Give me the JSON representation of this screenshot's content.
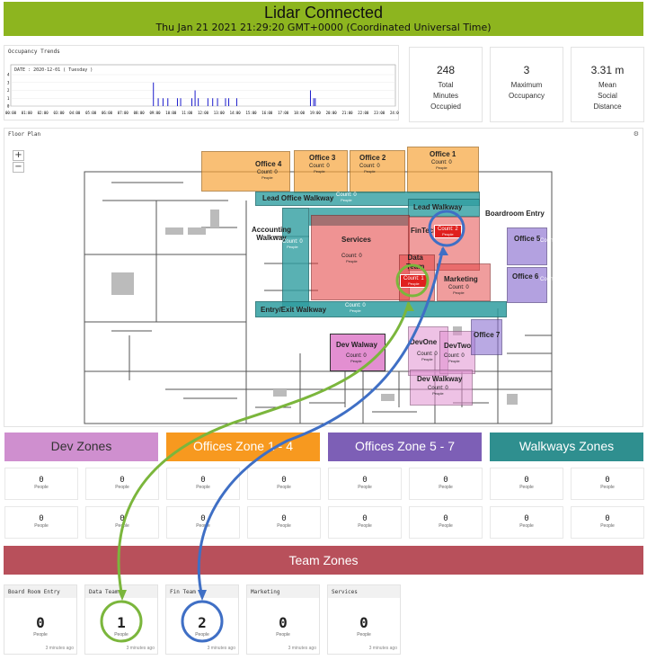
{
  "header": {
    "title": "Lidar Connected",
    "subtitle": "Thu Jan 21 2021 21:29:20 GMT+0000 (Coordinated Universal Time)"
  },
  "trends": {
    "title": "Occupancy Trends",
    "date_label": "DATE : 2020-12-01 ( Tuesday )",
    "y_ticks": [
      "4",
      "3",
      "2",
      "1",
      "0"
    ],
    "x_ticks": [
      "00:00",
      "01:00",
      "02:00",
      "03:00",
      "04:00",
      "05:00",
      "06:00",
      "07:00",
      "08:00",
      "09:00",
      "10:00",
      "11:00",
      "12:00",
      "13:00",
      "14:00",
      "15:00",
      "16:00",
      "17:00",
      "18:00",
      "19:00",
      "20:00",
      "21:00",
      "22:00",
      "23:00",
      "24:00"
    ],
    "bars": [
      [
        8.9,
        3
      ],
      [
        9.2,
        1
      ],
      [
        9.5,
        1
      ],
      [
        9.8,
        1
      ],
      [
        10.4,
        1
      ],
      [
        10.6,
        1
      ],
      [
        11.3,
        1
      ],
      [
        11.5,
        2
      ],
      [
        11.7,
        1
      ],
      [
        12.3,
        1
      ],
      [
        12.6,
        1
      ],
      [
        12.9,
        1
      ],
      [
        13.4,
        1
      ],
      [
        13.6,
        1
      ],
      [
        14.1,
        1
      ],
      [
        18.7,
        2
      ],
      [
        18.9,
        1
      ],
      [
        19.0,
        1
      ]
    ],
    "colors": {
      "bar": "#1c1ccc"
    }
  },
  "stats": [
    {
      "value": "248",
      "label1": "Total",
      "label2": "Minutes",
      "label3": "Occupied"
    },
    {
      "value": "3",
      "label1": "Maximum",
      "label2": "Occupancy",
      "label3": ""
    },
    {
      "value": "3.31 m",
      "label1": "Mean",
      "label2": "Social",
      "label3": "Distance"
    }
  ],
  "floor_plan": {
    "title": "Floor Plan",
    "zoom_in": "+",
    "zoom_out": "−",
    "settings_icon": "gear-icon",
    "count_text": "Count: 0",
    "people_text": "People",
    "zones": {
      "office4": {
        "label": "Office 4",
        "count": "Count: 0"
      },
      "office3": {
        "label": "Office 3",
        "count": "Count: 0"
      },
      "office2": {
        "label": "Office 2",
        "count": "Count: 0"
      },
      "office1": {
        "label": "Office 1",
        "count": "Count: 0"
      },
      "lead_office_walkway": {
        "label": "Lead Office Walkway",
        "count": "Count: 0"
      },
      "lead_walkway": {
        "label": "Lead Walkway",
        "count": ""
      },
      "boardroom_entry": {
        "label": "Boardroom Entry",
        "count": ""
      },
      "accounting_walkway": {
        "label": "Accounting Walkway",
        "count": "Count: 0"
      },
      "services": {
        "label": "Services",
        "count": "Count: 0"
      },
      "fintech": {
        "label": "FinTech",
        "count": "Count: 2"
      },
      "data_team": {
        "label": "Data Team",
        "count": "Count: 1"
      },
      "marketing": {
        "label": "Marketing",
        "count": "Count: 0"
      },
      "office5": {
        "label": "Office 5",
        "count": ""
      },
      "office6": {
        "label": "Office 6",
        "count": ""
      },
      "entry_exit_walkway": {
        "label": "Entry/Exit Walkway",
        "count": "Count: 0"
      },
      "dev_walway": {
        "label": "Dev Walway",
        "count": "Count: 0"
      },
      "devone": {
        "label": "DevOne",
        "count": "Count: 0"
      },
      "devtwo": {
        "label": "DevTwo",
        "count": "Count: 0"
      },
      "office7": {
        "label": "Office 7",
        "count": ""
      },
      "dev_walkway": {
        "label": "Dev Walkway",
        "count": "Count: 0"
      }
    },
    "colors": {
      "office": "#f6a43a",
      "walkway": "#2f9ea0",
      "red": "#e23b3b",
      "pink": "#e08fcf",
      "purple": "#8a6fd0",
      "green": "#7bb63c",
      "blue": "#3f6fc5"
    }
  },
  "zone_groups": [
    {
      "label": "Dev Zones",
      "color": "#cf8fcf"
    },
    {
      "label": "Offices Zone 1 - 4",
      "color": "#f7991f"
    },
    {
      "label": "Offices Zone 5 - 7",
      "color": "#7d5fb6"
    },
    {
      "label": "Walkways Zones",
      "color": "#2f8f8f"
    }
  ],
  "zone_cells": {
    "value": "0",
    "unit": "People"
  },
  "team": {
    "title": "Team Zones",
    "tiles": [
      {
        "title": "Board Room Entry",
        "value": "0",
        "unit": "People",
        "ago": "3 minutes ago"
      },
      {
        "title": "Data Team",
        "value": "1",
        "unit": "People",
        "ago": "3 minutes ago"
      },
      {
        "title": "Fin Team",
        "value": "2",
        "unit": "People",
        "ago": "3 minutes ago"
      },
      {
        "title": "Marketing",
        "value": "0",
        "unit": "People",
        "ago": "3 minutes ago"
      },
      {
        "title": "Services",
        "value": "0",
        "unit": "People",
        "ago": "3 minutes ago"
      }
    ]
  }
}
